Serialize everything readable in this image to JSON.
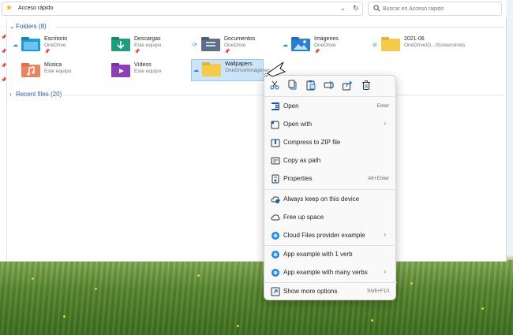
{
  "address": {
    "path": "Acceso rápido"
  },
  "search": {
    "placeholder": "Buscar en Acceso rápido"
  },
  "folders_header": "Folders (8)",
  "recent_header": "Recent files (20)",
  "folders": [
    {
      "name": "Escritorio",
      "sub": "OneDrive"
    },
    {
      "name": "Descargas",
      "sub": "Este equipo"
    },
    {
      "name": "Documentos",
      "sub": "OneDrive"
    },
    {
      "name": "Imágenes",
      "sub": "OneDrive"
    },
    {
      "name": "2021-06",
      "sub": "OneDrive\\D...\\Screenshots"
    },
    {
      "name": "Música",
      "sub": "Este equipo"
    },
    {
      "name": "Vídeos",
      "sub": "Este equipo"
    },
    {
      "name": "Wallpapers",
      "sub": "OneDrive\\Imágenes"
    }
  ],
  "menu": {
    "toolbar": [
      "cut-icon",
      "copy-icon",
      "paste-icon",
      "rename-icon",
      "share-icon",
      "delete-icon"
    ],
    "items": [
      {
        "label": "Open",
        "shortcut": "Enter"
      },
      {
        "label": "Open with",
        "shortcut": "›"
      },
      {
        "label": "Compress to ZIP file",
        "shortcut": ""
      },
      {
        "label": "Copy as path",
        "shortcut": ""
      },
      {
        "label": "Properties",
        "shortcut": "Alt+Enter"
      },
      {
        "label": "Always keep on this device",
        "shortcut": ""
      },
      {
        "label": "Free up space",
        "shortcut": ""
      },
      {
        "label": "Cloud Files provider example",
        "shortcut": "›"
      },
      {
        "label": "App example with 1 verb",
        "shortcut": ""
      },
      {
        "label": "App example with many verbs",
        "shortcut": "›"
      },
      {
        "label": "Show more options",
        "shortcut": "Shift+F10"
      }
    ]
  },
  "colors": {
    "accent": "#0067c0",
    "selection": "#cce4f7",
    "folder_yellow": "#f6c94a"
  }
}
